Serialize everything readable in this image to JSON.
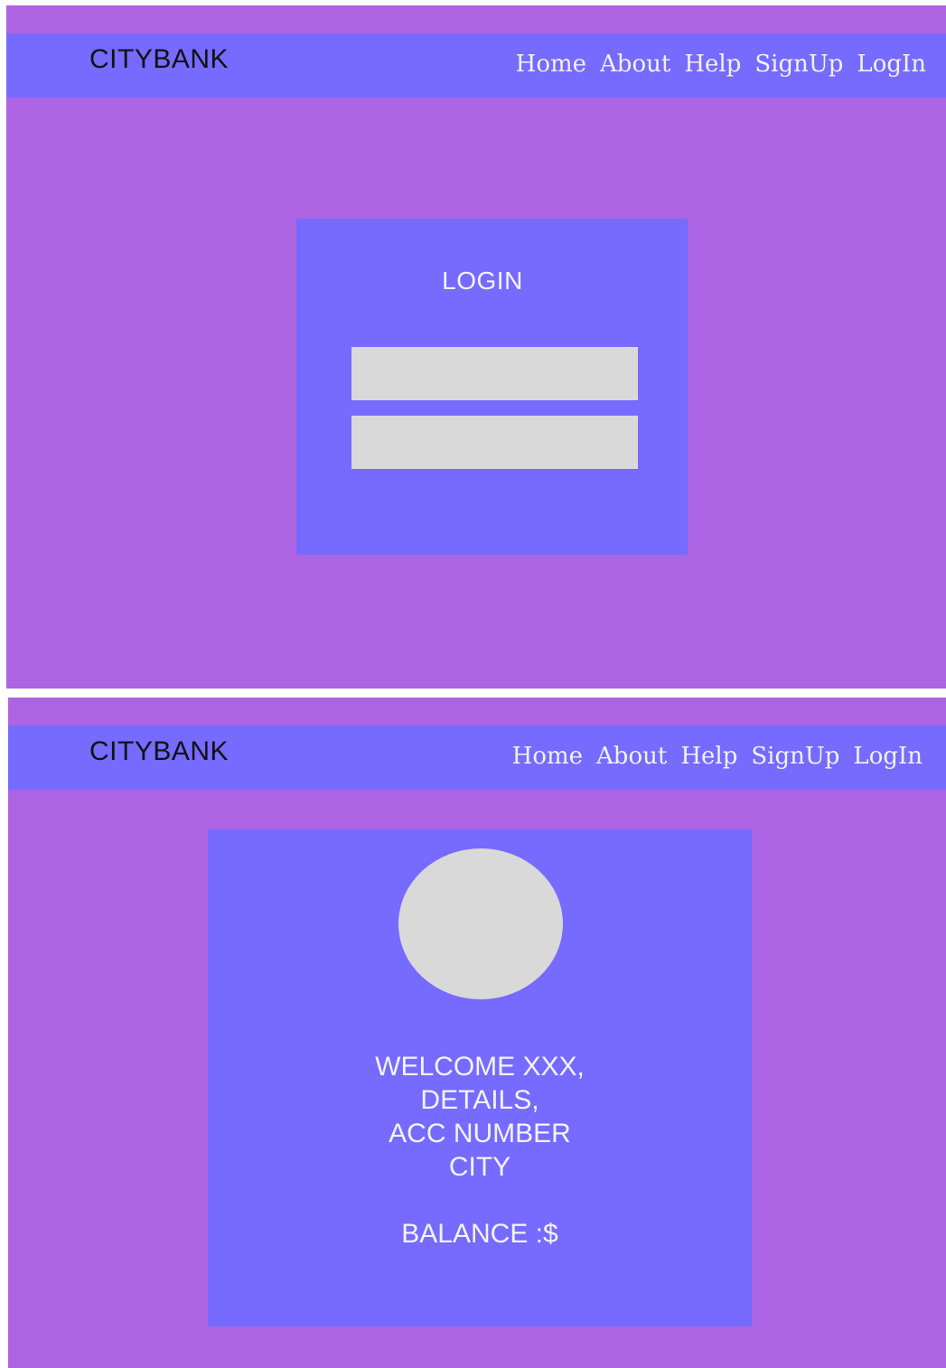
{
  "colors": {
    "background": "#ad64e2",
    "navbar": "#766aff",
    "card": "#766aff",
    "placeholder": "#d9d9d9"
  },
  "login_page": {
    "brand": "CITYBANK",
    "nav": [
      "Home",
      "About",
      "Help",
      "SignUp",
      "LogIn"
    ],
    "card": {
      "title": "LOGIN",
      "fields": [
        {
          "value": "",
          "placeholder": ""
        },
        {
          "value": "",
          "placeholder": ""
        }
      ]
    }
  },
  "account_page": {
    "brand": "CITYBANK",
    "nav": [
      "Home",
      "About",
      "Help",
      "SignUp",
      "LogIn"
    ],
    "card": {
      "avatar_icon": "user-avatar-placeholder",
      "lines": [
        "WELCOME XXX,",
        "DETAILS,",
        "ACC NUMBER",
        "CITY"
      ],
      "balance": "BALANCE :$"
    }
  }
}
